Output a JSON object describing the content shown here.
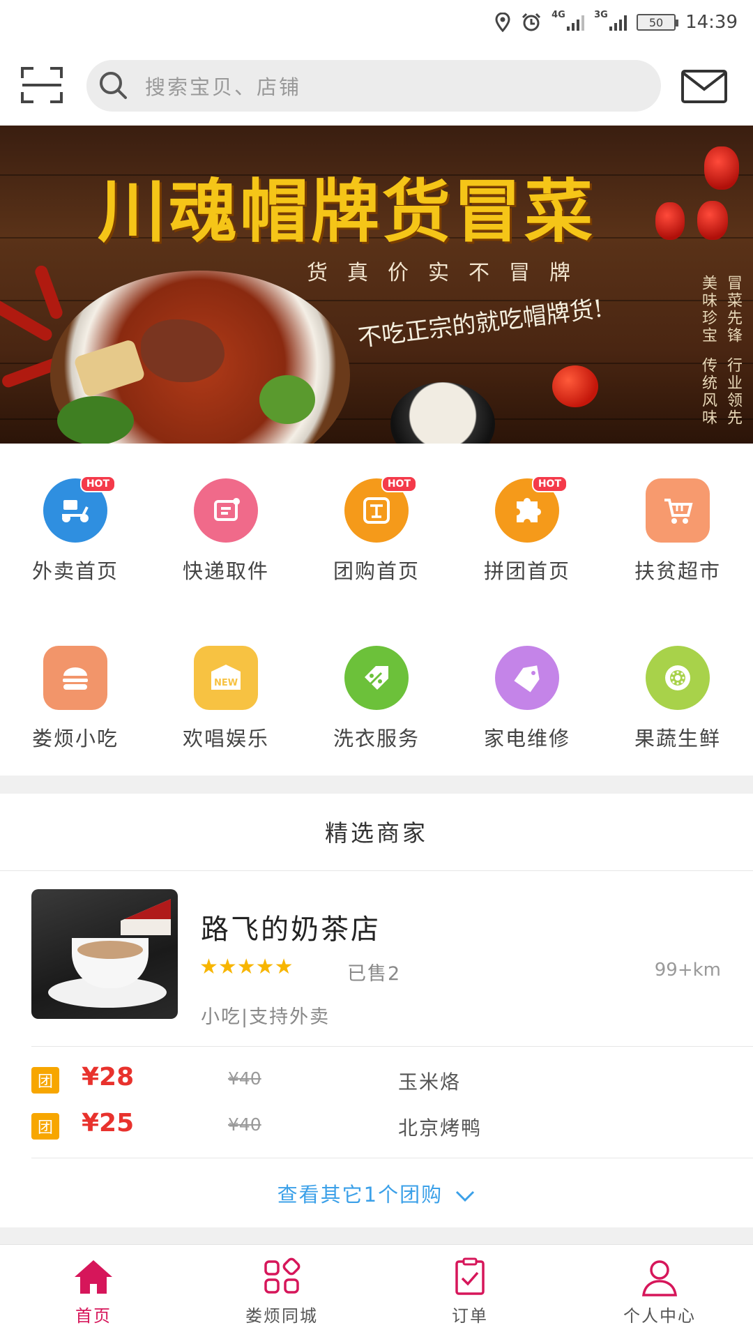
{
  "status_bar": {
    "time": "14:39",
    "battery": "50",
    "net1": "4G",
    "net2": "3G"
  },
  "header": {
    "search_placeholder": "搜索宝贝、店铺"
  },
  "banner": {
    "title": "川魂帽牌货冒菜",
    "subtitle": "货真价实不冒牌",
    "slogan": "不吃正宗的就吃帽牌货!",
    "side_text_1": "冒菜先锋",
    "side_text_2": "美味珍宝",
    "side_text_3": "行业领先",
    "side_text_4": "传统风味"
  },
  "categories": [
    {
      "label": "外卖首页",
      "color": "#2f8fe0",
      "hot": "HOT",
      "icon": "scooter-icon"
    },
    {
      "label": "快递取件",
      "color": "#f06a8a",
      "hot": "",
      "icon": "delivery-icon"
    },
    {
      "label": "团购首页",
      "color": "#f59a1a",
      "hot": "HOT",
      "icon": "group-buy-icon"
    },
    {
      "label": "拼团首页",
      "color": "#f59a1a",
      "hot": "HOT",
      "icon": "puzzle-icon"
    },
    {
      "label": "扶贫超市",
      "color": "#f79a6e",
      "hot": "",
      "icon": "cart-icon"
    },
    {
      "label": "娄烦小吃",
      "color": "#f2956a",
      "hot": "",
      "icon": "burger-icon"
    },
    {
      "label": "欢唱娱乐",
      "color": "#f7c242",
      "hot": "",
      "icon": "new-icon",
      "icon_text": "NEW"
    },
    {
      "label": "洗衣服务",
      "color": "#6cc13a",
      "hot": "",
      "icon": "tag-percent-icon"
    },
    {
      "label": "家电维修",
      "color": "#c484e8",
      "hot": "",
      "icon": "price-tag-icon"
    },
    {
      "label": "果蔬生鲜",
      "color": "#a8d24a",
      "hot": "",
      "icon": "kiwi-icon"
    }
  ],
  "section": {
    "title": "精选商家"
  },
  "shop": {
    "name": "路飞的奶茶店",
    "rating": 5,
    "stars": "★★★★★",
    "sold": "已售2",
    "distance": "99+km",
    "tags": "小吃|支持外卖"
  },
  "deals": [
    {
      "badge": "团",
      "price": "¥28",
      "original": "¥40",
      "name": "玉米烙"
    },
    {
      "badge": "团",
      "price": "¥25",
      "original": "¥40",
      "name": "北京烤鸭"
    }
  ],
  "more_link": "查看其它1个团购",
  "tabbar": [
    {
      "label": "首页",
      "active": true,
      "icon": "home-icon"
    },
    {
      "label": "娄烦同城",
      "active": false,
      "icon": "grid-icon"
    },
    {
      "label": "订单",
      "active": false,
      "icon": "clipboard-check-icon"
    },
    {
      "label": "个人中心",
      "active": false,
      "icon": "user-icon"
    }
  ],
  "colors": {
    "accent": "#d6165a",
    "price": "#e8322d",
    "link": "#3ba0e8",
    "badge": "#f7a600",
    "star": "#f7b500"
  }
}
